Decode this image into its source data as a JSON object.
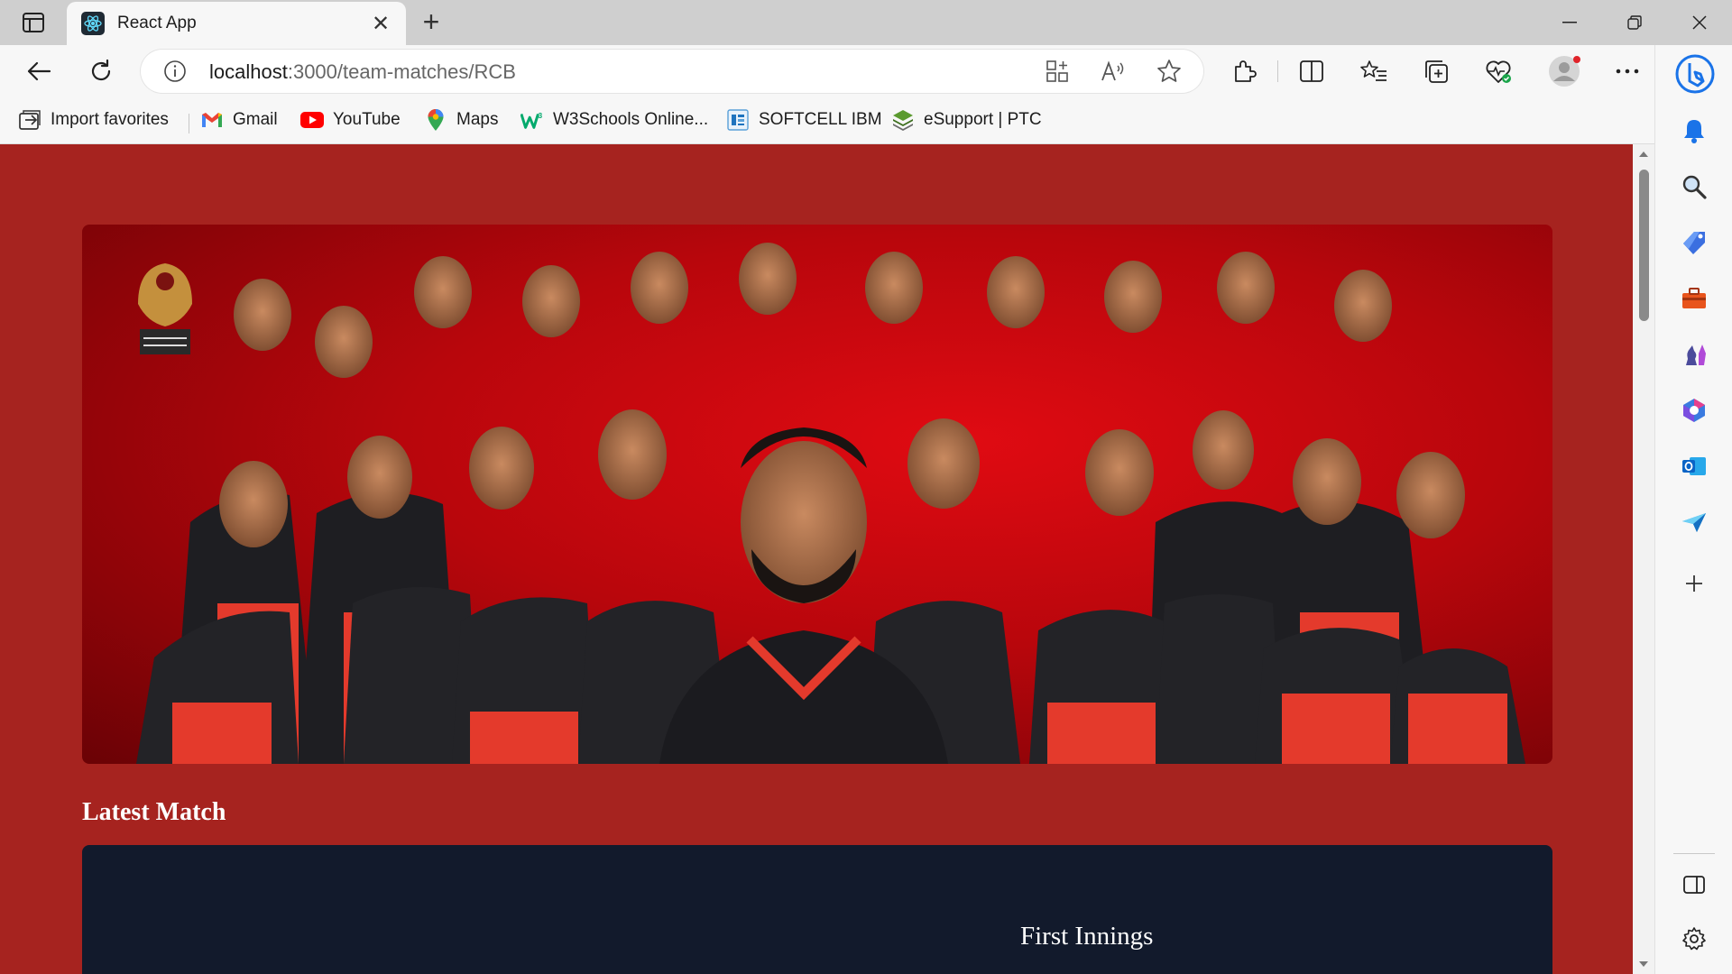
{
  "browser": {
    "tab": {
      "title": "React App",
      "close_glyph": "✕"
    },
    "new_tab_glyph": "+",
    "address": {
      "host": "localhost",
      "path": ":3000/team-matches/RCB"
    },
    "favorites": [
      {
        "label": "Import favorites",
        "icon": "import-icon"
      },
      {
        "label": "Gmail",
        "icon": "gmail-icon"
      },
      {
        "label": "YouTube",
        "icon": "youtube-icon"
      },
      {
        "label": "Maps",
        "icon": "maps-icon"
      },
      {
        "label": "W3Schools Online...",
        "icon": "w3schools-icon"
      },
      {
        "label": "SOFTCELL IBM",
        "icon": "softcell-icon"
      },
      {
        "label": "eSupport | PTC",
        "icon": "esupport-icon"
      }
    ],
    "colors": {
      "accent": "#0078d4",
      "tab_bg": "#f7f7f7",
      "titlebar_bg": "#cfcfcf"
    }
  },
  "page": {
    "background": "#a6231f",
    "section_title": "Latest Match",
    "match_card": {
      "background": "#121a2c",
      "innings_label": "First Innings"
    },
    "hero_image": {
      "description_icon": "team-photo"
    }
  }
}
